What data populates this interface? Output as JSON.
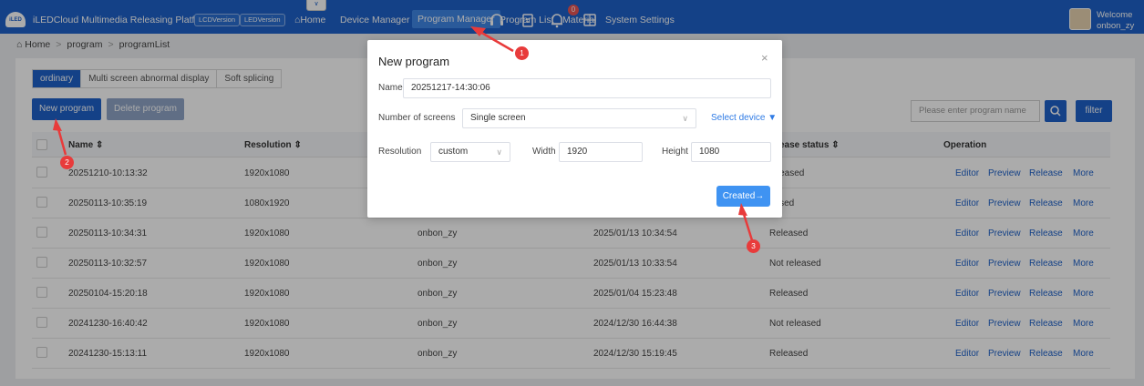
{
  "navbar": {
    "title": "iLEDCloud Multimedia Releasing Platform",
    "logo_text": "iLED",
    "versions": [
      "LCDVersion",
      "LEDVersion"
    ],
    "menu": [
      "Home",
      "Device Manager",
      "Program Manager",
      "Program List",
      "Material",
      "System Settings"
    ],
    "active_menu": "Program Manager",
    "notification_count": "0",
    "user_greeting": "Welcome",
    "username": "onbon_zy",
    "icons": [
      "home-icon",
      "headset-icon",
      "clipboard-icon",
      "bell-icon",
      "grid-icon",
      "chevron-down-icon"
    ]
  },
  "breadcrumb": [
    "Home",
    "program",
    "programList"
  ],
  "tabs": [
    "ordinary",
    "Multi screen abnormal display",
    "Soft splicing"
  ],
  "active_tab": "ordinary",
  "toolbar": {
    "new_program": "New program",
    "delete_program": "Delete program",
    "search_placeholder": "Please enter program name",
    "filter": "filter"
  },
  "table": {
    "columns": [
      "Name",
      "Resolution",
      "",
      "",
      "Release status",
      "Operation"
    ],
    "release_status_visible": "ease status",
    "operations": [
      "Editor",
      "Preview",
      "Release",
      "More"
    ],
    "rows": [
      {
        "name": "20251210-10:13:32",
        "resolution": "1920x1080",
        "user": "",
        "time": "",
        "status": "released"
      },
      {
        "name": "20250113-10:35:19",
        "resolution": "1080x1920",
        "user": "",
        "time": "",
        "status": "eased"
      },
      {
        "name": "20250113-10:34:31",
        "resolution": "1920x1080",
        "user": "onbon_zy",
        "time": "2025/01/13 10:34:54",
        "status": "Released"
      },
      {
        "name": "20250113-10:32:57",
        "resolution": "1920x1080",
        "user": "onbon_zy",
        "time": "2025/01/13 10:33:54",
        "status": "Not released"
      },
      {
        "name": "20250104-15:20:18",
        "resolution": "1920x1080",
        "user": "onbon_zy",
        "time": "2025/01/04 15:23:48",
        "status": "Released"
      },
      {
        "name": "20241230-16:40:42",
        "resolution": "1920x1080",
        "user": "onbon_zy",
        "time": "2024/12/30 16:44:38",
        "status": "Not released"
      },
      {
        "name": "20241230-15:13:11",
        "resolution": "1920x1080",
        "user": "onbon_zy",
        "time": "2024/12/30 15:19:45",
        "status": "Released"
      }
    ]
  },
  "modal": {
    "title": "New program",
    "name_label": "Name",
    "name_value": "20251217-14:30:06",
    "screens_label": "Number of screens",
    "screens_value": "Single screen",
    "select_device": "Select device ▼",
    "resolution_label": "Resolution",
    "resolution_value": "custom",
    "width_label": "Width",
    "width_value": "1920",
    "height_label": "Height",
    "height_value": "1080",
    "created_button": "Created→"
  },
  "callouts": [
    "1",
    "2",
    "3"
  ],
  "colors": {
    "primary": "#1f62c9",
    "accent": "#3f93f2",
    "callout": "#e83b3b"
  }
}
